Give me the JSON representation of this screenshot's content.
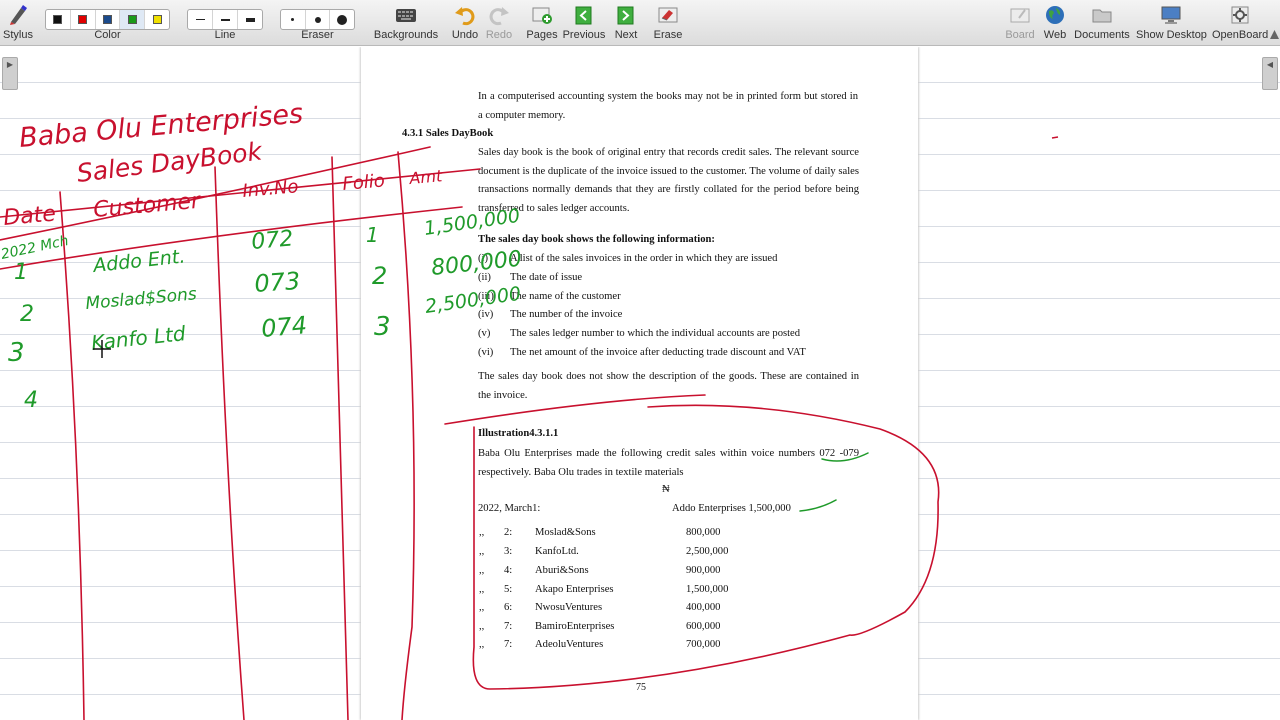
{
  "toolbar": {
    "stylus": "Stylus",
    "color": "Color",
    "line": "Line",
    "eraser": "Eraser",
    "backgrounds": "Backgrounds",
    "undo": "Undo",
    "redo": "Redo",
    "pages": "Pages",
    "previous": "Previous",
    "next": "Next",
    "erase": "Erase",
    "board": "Board",
    "web": "Web",
    "documents": "Documents",
    "show_desktop": "Show Desktop",
    "openboard": "OpenBoard",
    "colors": [
      "#111111",
      "#e00000",
      "#1c4b8c",
      "#1a9a1a",
      "#f0e000"
    ]
  },
  "document": {
    "intro": "In a computerised accounting system the books may not be in printed form but stored in a computer memory.",
    "section_heading": "4.3.1 Sales DayBook",
    "para1": "Sales day book is the book of original entry that records credit sales. The relevant source document is the duplicate of the invoice issued to the customer. The volume of daily sales transactions normally demands that they are firstly collated for the period before being transferred to sales ledger accounts.",
    "info_heading": "The sales day book shows the following information:",
    "info_items": [
      {
        "num": "(i)",
        "text": "A list of the sales invoices in the order in which  they are issued"
      },
      {
        "num": "(ii)",
        "text": "The date of issue"
      },
      {
        "num": "(iii)",
        "text": "The name of the customer"
      },
      {
        "num": "(iv)",
        "text": "The number of the invoice"
      },
      {
        "num": "(v)",
        "text": "The sales ledger number to which the individual accounts are posted"
      },
      {
        "num": "(vi)",
        "text": "The net amount of the invoice after deducting trade discount and VAT"
      }
    ],
    "para2": "The sales day book does not show the description of the goods. These are contained in the invoice.",
    "illustration_heading": "Illustration4.3.1.1",
    "illustration_text": "Baba Olu Enterprises made the following credit sales within voice numbers 072 -079 respectively. Baba Olu trades in textile materials",
    "currency_symbol": "₦",
    "first_line_date": "2022, March1:",
    "first_line_customer": "Addo Enterprises 1,500,000",
    "sales": [
      {
        "marks": ",,",
        "day": "2:",
        "customer": "Moslad&Sons",
        "amount": "800,000"
      },
      {
        "marks": ",,",
        "day": "3:",
        "customer": "KanfoLtd.",
        "amount": "2,500,000"
      },
      {
        "marks": ",,",
        "day": "4:",
        "customer": "Aburi&Sons",
        "amount": "900,000"
      },
      {
        "marks": ",,",
        "day": "5:",
        "customer": "Akapo Enterprises",
        "amount": "1,500,000"
      },
      {
        "marks": ",,",
        "day": "6:",
        "customer": "NwosuVentures",
        "amount": "400,000"
      },
      {
        "marks": ",,",
        "day": "7:",
        "customer": "BamiroEnterprises",
        "amount": "600,000"
      },
      {
        "marks": ",,",
        "day": "7:",
        "customer": "AdeoluVentures",
        "amount": "700,000"
      }
    ],
    "page_number": "75"
  },
  "annotations": {
    "title_line1": "Baba Olu Enterprises",
    "title_line2": "Sales DayBook",
    "headers": [
      "Date",
      "Customer",
      "Inv.No",
      "Folio",
      "Amt"
    ],
    "date_label": "2022 Mch",
    "rows": [
      {
        "date": "1",
        "customer": "Addo Ent.",
        "inv": "072",
        "folio": "1",
        "amount": "1,500,000"
      },
      {
        "date": "2",
        "customer": "Moslad$Sons",
        "inv": "073",
        "folio": "2",
        "amount": "800,000"
      },
      {
        "date": "3",
        "customer": "Kanfo Ltd",
        "inv": "074",
        "folio": "3",
        "amount": "2,500,000"
      },
      {
        "date": "4",
        "customer": "",
        "inv": "",
        "folio": "",
        "amount": ""
      }
    ],
    "ink_red": "#c8102e",
    "ink_green": "#1f9a2a"
  }
}
